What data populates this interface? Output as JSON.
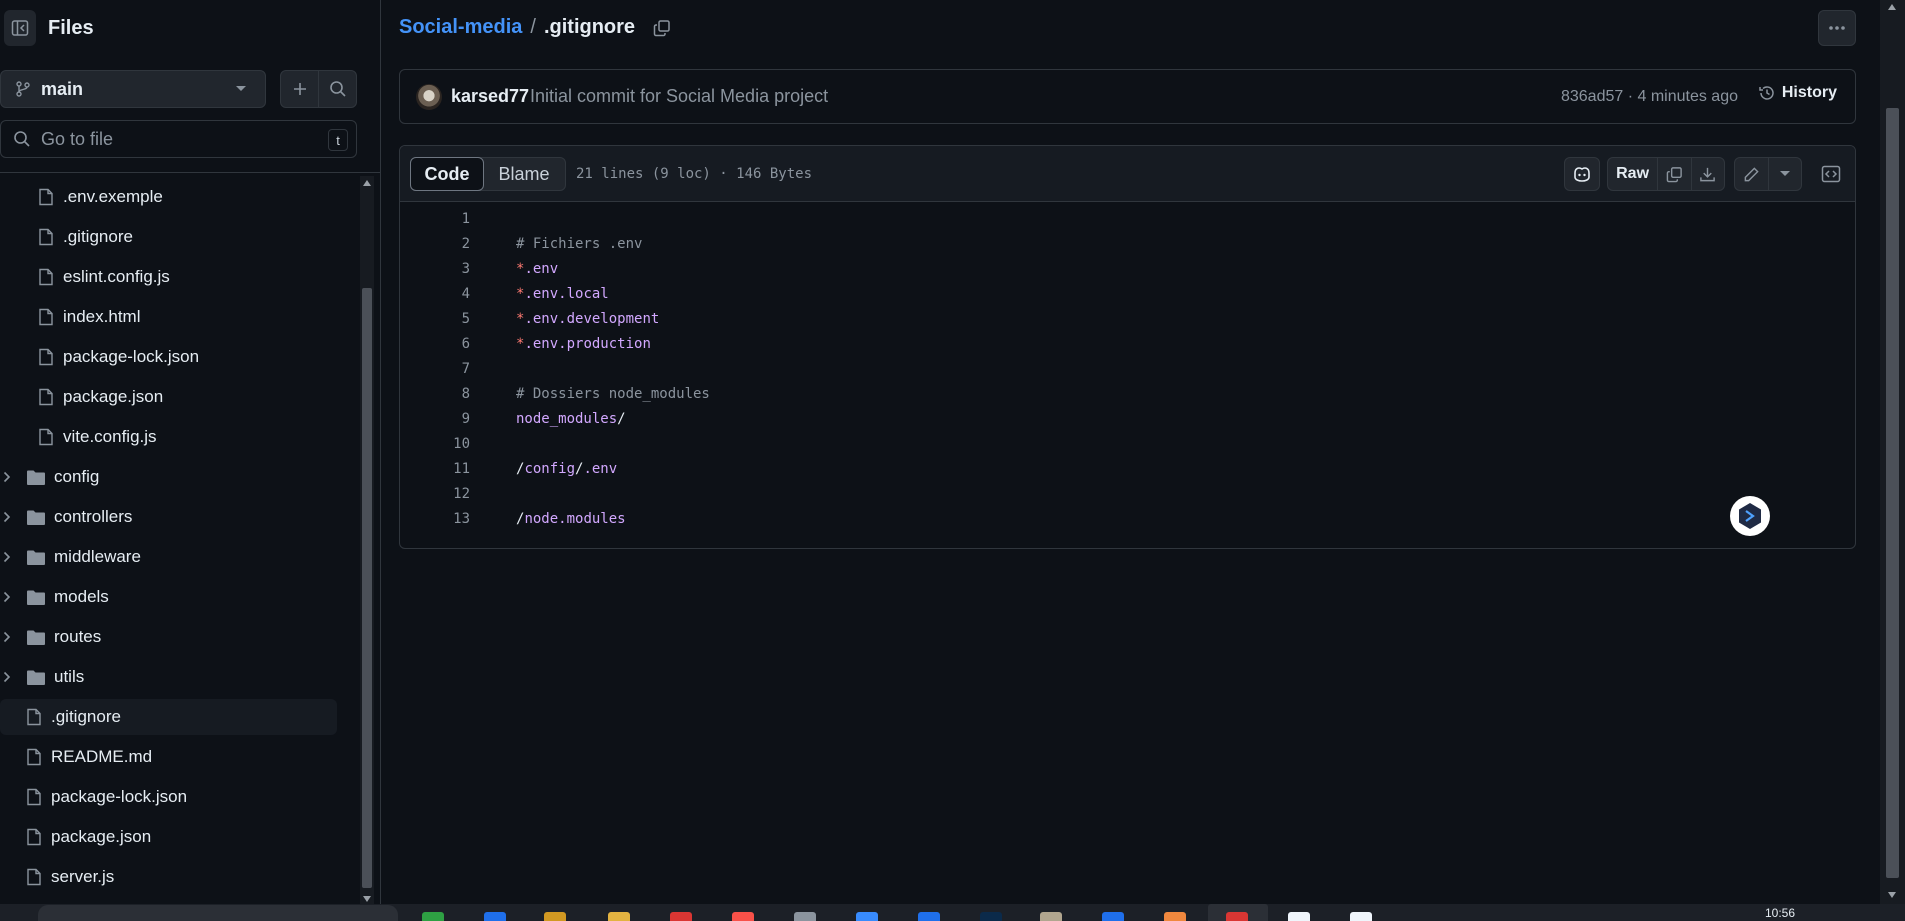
{
  "sidebar": {
    "title": "Files",
    "branch": "main",
    "goto_placeholder": "Go to file",
    "goto_shortcut": "t",
    "tree": [
      {
        "label": ".env.exemple",
        "type": "file",
        "indent": 1
      },
      {
        "label": ".gitignore",
        "type": "file",
        "indent": 1
      },
      {
        "label": "eslint.config.js",
        "type": "file",
        "indent": 1
      },
      {
        "label": "index.html",
        "type": "file",
        "indent": 1
      },
      {
        "label": "package-lock.json",
        "type": "file",
        "indent": 1
      },
      {
        "label": "package.json",
        "type": "file",
        "indent": 1
      },
      {
        "label": "vite.config.js",
        "type": "file",
        "indent": 1
      },
      {
        "label": "config",
        "type": "folder",
        "indent": 0
      },
      {
        "label": "controllers",
        "type": "folder",
        "indent": 0
      },
      {
        "label": "middleware",
        "type": "folder",
        "indent": 0
      },
      {
        "label": "models",
        "type": "folder",
        "indent": 0
      },
      {
        "label": "routes",
        "type": "folder",
        "indent": 0
      },
      {
        "label": "utils",
        "type": "folder",
        "indent": 0
      },
      {
        "label": ".gitignore",
        "type": "file",
        "indent": 0,
        "selected": true
      },
      {
        "label": "README.md",
        "type": "file",
        "indent": 0
      },
      {
        "label": "package-lock.json",
        "type": "file",
        "indent": 0
      },
      {
        "label": "package.json",
        "type": "file",
        "indent": 0
      },
      {
        "label": "server.js",
        "type": "file",
        "indent": 0
      }
    ]
  },
  "breadcrumb": {
    "repo": "Social-media",
    "separator": "/",
    "file": ".gitignore"
  },
  "commit": {
    "author": "karsed77",
    "message": "Initial commit for Social Media project",
    "meta": "836ad57 · 4 minutes ago",
    "history_label": "History"
  },
  "file": {
    "tabs": {
      "code": "Code",
      "blame": "Blame"
    },
    "info": "21 lines (9 loc) · 146 Bytes",
    "raw_label": "Raw",
    "lines": [
      {
        "n": "1",
        "parts": []
      },
      {
        "n": "2",
        "parts": [
          {
            "t": "# Fichiers .env",
            "c": "t-comment"
          }
        ]
      },
      {
        "n": "3",
        "parts": [
          {
            "t": "*",
            "c": "t-op"
          },
          {
            "t": ".env",
            "c": "t-str"
          }
        ]
      },
      {
        "n": "4",
        "parts": [
          {
            "t": "*",
            "c": "t-op"
          },
          {
            "t": ".env.local",
            "c": "t-str"
          }
        ]
      },
      {
        "n": "5",
        "parts": [
          {
            "t": "*",
            "c": "t-op"
          },
          {
            "t": ".env.development",
            "c": "t-str"
          }
        ]
      },
      {
        "n": "6",
        "parts": [
          {
            "t": "*",
            "c": "t-op"
          },
          {
            "t": ".env.production",
            "c": "t-str"
          }
        ]
      },
      {
        "n": "7",
        "parts": []
      },
      {
        "n": "8",
        "parts": [
          {
            "t": "# Dossiers node_modules",
            "c": "t-comment"
          }
        ]
      },
      {
        "n": "9",
        "parts": [
          {
            "t": "node_modules",
            "c": "t-str"
          },
          {
            "t": "/",
            "c": "t-plain"
          }
        ]
      },
      {
        "n": "10",
        "parts": []
      },
      {
        "n": "11",
        "parts": [
          {
            "t": "/",
            "c": "t-plain"
          },
          {
            "t": "config",
            "c": "t-str"
          },
          {
            "t": "/",
            "c": "t-plain"
          },
          {
            "t": ".env",
            "c": "t-str"
          }
        ]
      },
      {
        "n": "12",
        "parts": []
      },
      {
        "n": "13",
        "parts": [
          {
            "t": "/",
            "c": "t-plain"
          },
          {
            "t": "node.modules",
            "c": "t-str"
          }
        ]
      }
    ]
  },
  "taskbar": {
    "clock": "10:56"
  },
  "colors": {
    "accent": "#4493f8",
    "bg": "#0d1117",
    "border": "#30363d",
    "comment": "#8b949e",
    "string": "#d2a8ff",
    "operator": "#ff7b72"
  }
}
